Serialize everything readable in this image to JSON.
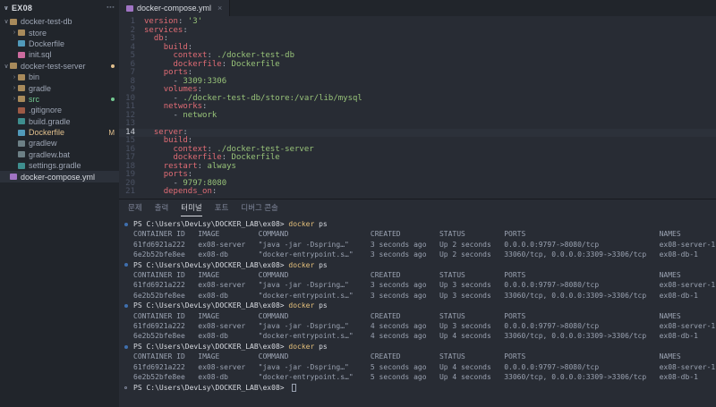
{
  "colors": {
    "yaml_key": "#e06c75",
    "yaml_string": "#98c379",
    "command_highlight": "#e5c07b",
    "git_modified": "#e2c08d",
    "git_untracked": "#73c991",
    "selection_bg": "#2c313a"
  },
  "sidebar": {
    "title": "EX08",
    "items": [
      {
        "label": "docker-test-db",
        "kind": "folder",
        "expanded": true,
        "indent": 0,
        "icon": "folder"
      },
      {
        "label": "store",
        "kind": "folder",
        "expanded": false,
        "indent": 1,
        "icon": "folder"
      },
      {
        "label": "Dockerfile",
        "kind": "file",
        "indent": 1,
        "icon": "docker"
      },
      {
        "label": "init.sql",
        "kind": "file",
        "indent": 1,
        "icon": "sql"
      },
      {
        "label": "docker-test-server",
        "kind": "folder",
        "expanded": true,
        "indent": 0,
        "icon": "folder",
        "badge": "dot",
        "badge_color": "#e2c08d"
      },
      {
        "label": "bin",
        "kind": "folder",
        "expanded": false,
        "indent": 1,
        "icon": "folder"
      },
      {
        "label": "gradle",
        "kind": "folder",
        "expanded": false,
        "indent": 1,
        "icon": "folder"
      },
      {
        "label": "src",
        "kind": "folder",
        "expanded": false,
        "indent": 1,
        "icon": "folder",
        "badge": "dot",
        "badge_color": "#73c991",
        "text_color": "#73c991"
      },
      {
        "label": ".gitignore",
        "kind": "file",
        "indent": 1,
        "icon": "git"
      },
      {
        "label": "build.gradle",
        "kind": "file",
        "indent": 1,
        "icon": "gradle"
      },
      {
        "label": "Dockerfile",
        "kind": "file",
        "indent": 1,
        "icon": "docker",
        "badge": "M",
        "badge_color": "#e2c08d",
        "text_color": "#e2c08d"
      },
      {
        "label": "gradlew",
        "kind": "file",
        "indent": 1,
        "icon": "file"
      },
      {
        "label": "gradlew.bat",
        "kind": "file",
        "indent": 1,
        "icon": "file"
      },
      {
        "label": "settings.gradle",
        "kind": "file",
        "indent": 1,
        "icon": "gradle"
      },
      {
        "label": "docker-compose.yml",
        "kind": "file",
        "indent": 0,
        "icon": "yml",
        "selected": true
      }
    ]
  },
  "editor": {
    "tab_label": "docker-compose.yml",
    "current_line": 14,
    "lines": [
      {
        "n": "1",
        "tokens": [
          [
            "k",
            "version"
          ],
          [
            "p",
            ":"
          ],
          [
            "s",
            " '3'"
          ]
        ]
      },
      {
        "n": "2",
        "tokens": [
          [
            "k",
            "services"
          ],
          [
            "p",
            ":"
          ]
        ]
      },
      {
        "n": "3",
        "tokens": [
          [
            "w",
            "  "
          ],
          [
            "k",
            "db"
          ],
          [
            "p",
            ":"
          ]
        ]
      },
      {
        "n": "4",
        "tokens": [
          [
            "w",
            "    "
          ],
          [
            "k",
            "build"
          ],
          [
            "p",
            ":"
          ]
        ]
      },
      {
        "n": "5",
        "tokens": [
          [
            "w",
            "      "
          ],
          [
            "k",
            "context"
          ],
          [
            "p",
            ":"
          ],
          [
            "s",
            " ./docker-test-db"
          ]
        ]
      },
      {
        "n": "6",
        "tokens": [
          [
            "w",
            "      "
          ],
          [
            "k",
            "dockerfile"
          ],
          [
            "p",
            ":"
          ],
          [
            "s",
            " Dockerfile"
          ]
        ]
      },
      {
        "n": "7",
        "tokens": [
          [
            "w",
            "    "
          ],
          [
            "k",
            "ports"
          ],
          [
            "p",
            ":"
          ]
        ]
      },
      {
        "n": "8",
        "tokens": [
          [
            "w",
            "      "
          ],
          [
            "p",
            "- "
          ],
          [
            "s",
            "3309:3306"
          ]
        ]
      },
      {
        "n": "9",
        "tokens": [
          [
            "w",
            "    "
          ],
          [
            "k",
            "volumes"
          ],
          [
            "p",
            ":"
          ]
        ]
      },
      {
        "n": "10",
        "tokens": [
          [
            "w",
            "      "
          ],
          [
            "p",
            "- "
          ],
          [
            "s",
            "./docker-test-db/store:/var/lib/mysql"
          ]
        ]
      },
      {
        "n": "11",
        "tokens": [
          [
            "w",
            "    "
          ],
          [
            "k",
            "networks"
          ],
          [
            "p",
            ":"
          ]
        ]
      },
      {
        "n": "12",
        "tokens": [
          [
            "w",
            "      "
          ],
          [
            "p",
            "- "
          ],
          [
            "s",
            "network"
          ]
        ]
      },
      {
        "n": "13",
        "tokens": []
      },
      {
        "n": "14",
        "current": true,
        "tokens": [
          [
            "w",
            "  "
          ],
          [
            "k",
            "server"
          ],
          [
            "p",
            ":"
          ]
        ]
      },
      {
        "n": "15",
        "tokens": [
          [
            "w",
            "    "
          ],
          [
            "k",
            "build"
          ],
          [
            "p",
            ":"
          ]
        ]
      },
      {
        "n": "16",
        "tokens": [
          [
            "w",
            "      "
          ],
          [
            "k",
            "context"
          ],
          [
            "p",
            ":"
          ],
          [
            "s",
            " ./docker-test-server"
          ]
        ]
      },
      {
        "n": "17",
        "tokens": [
          [
            "w",
            "      "
          ],
          [
            "k",
            "dockerfile"
          ],
          [
            "p",
            ":"
          ],
          [
            "s",
            " Dockerfile"
          ]
        ]
      },
      {
        "n": "18",
        "tokens": [
          [
            "w",
            "    "
          ],
          [
            "k",
            "restart"
          ],
          [
            "p",
            ":"
          ],
          [
            "s",
            " always"
          ]
        ]
      },
      {
        "n": "19",
        "tokens": [
          [
            "w",
            "    "
          ],
          [
            "k",
            "ports"
          ],
          [
            "p",
            ":"
          ]
        ]
      },
      {
        "n": "20",
        "tokens": [
          [
            "w",
            "      "
          ],
          [
            "p",
            "- "
          ],
          [
            "s",
            "9797:8080"
          ]
        ]
      },
      {
        "n": "21",
        "tokens": [
          [
            "w",
            "    "
          ],
          [
            "k",
            "depends_on"
          ],
          [
            "p",
            ":"
          ]
        ]
      }
    ]
  },
  "terminal": {
    "tabs": [
      {
        "label": "문제",
        "name": "problems"
      },
      {
        "label": "출력",
        "name": "output"
      },
      {
        "label": "터미널",
        "name": "terminal",
        "active": true
      },
      {
        "label": "포트",
        "name": "ports"
      },
      {
        "label": "디버그 콘솔",
        "name": "debug-console"
      }
    ],
    "prompt": "PS C:\\Users\\DevLsy\\DOCKER_LAB\\ex08>",
    "command": "docker",
    "command_args": "ps",
    "columns": [
      "CONTAINER ID",
      "IMAGE",
      "COMMAND",
      "CREATED",
      "STATUS",
      "PORTS",
      "NAMES"
    ],
    "runs": [
      {
        "rows": [
          [
            "61fd6921a222",
            "ex08-server",
            "\"java -jar -Dspring…\"",
            "3 seconds ago",
            "Up 2 seconds",
            "0.0.0.0:9797->8080/tcp",
            "ex08-server-1"
          ],
          [
            "6e2b52bfe8ee",
            "ex08-db",
            "\"docker-entrypoint.s…\"",
            "3 seconds ago",
            "Up 2 seconds",
            "33060/tcp, 0.0.0.0:3309->3306/tcp",
            "ex08-db-1"
          ]
        ]
      },
      {
        "rows": [
          [
            "61fd6921a222",
            "ex08-server",
            "\"java -jar -Dspring…\"",
            "3 seconds ago",
            "Up 3 seconds",
            "0.0.0.0:9797->8080/tcp",
            "ex08-server-1"
          ],
          [
            "6e2b52bfe8ee",
            "ex08-db",
            "\"docker-entrypoint.s…\"",
            "3 seconds ago",
            "Up 3 seconds",
            "33060/tcp, 0.0.0.0:3309->3306/tcp",
            "ex08-db-1"
          ]
        ]
      },
      {
        "rows": [
          [
            "61fd6921a222",
            "ex08-server",
            "\"java -jar -Dspring…\"",
            "4 seconds ago",
            "Up 3 seconds",
            "0.0.0.0:9797->8080/tcp",
            "ex08-server-1"
          ],
          [
            "6e2b52bfe8ee",
            "ex08-db",
            "\"docker-entrypoint.s…\"",
            "4 seconds ago",
            "Up 4 seconds",
            "33060/tcp, 0.0.0.0:3309->3306/tcp",
            "ex08-db-1"
          ]
        ]
      },
      {
        "rows": [
          [
            "61fd6921a222",
            "ex08-server",
            "\"java -jar -Dspring…\"",
            "5 seconds ago",
            "Up 4 seconds",
            "0.0.0.0:9797->8080/tcp",
            "ex08-server-1"
          ],
          [
            "6e2b52bfe8ee",
            "ex08-db",
            "\"docker-entrypoint.s…\"",
            "5 seconds ago",
            "Up 4 seconds",
            "33060/tcp, 0.0.0.0:3309->3306/tcp",
            "ex08-db-1"
          ]
        ]
      }
    ]
  }
}
